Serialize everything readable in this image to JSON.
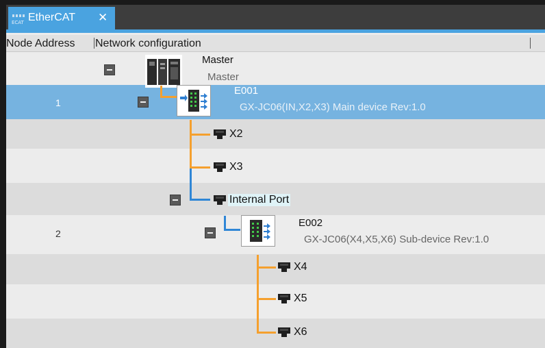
{
  "tab": {
    "label": "EtherCAT",
    "close_glyph": "✕",
    "icon": "ethercat-icon"
  },
  "header": {
    "node_address": "Node Address",
    "network_configuration": "Network configuration"
  },
  "master": {
    "name": "Master",
    "model": "Master"
  },
  "devices": [
    {
      "address": "1",
      "name": "E001",
      "model": "GX-JC06(IN,X2,X3) Main device Rev:1.0",
      "selected": true
    },
    {
      "address": "2",
      "name": "E002",
      "model": "GX-JC06(X4,X5,X6) Sub-device Rev:1.0",
      "selected": false
    }
  ],
  "ports": {
    "e001": [
      "X2",
      "X3",
      "Internal Port"
    ],
    "e002": [
      "X4",
      "X5",
      "X6"
    ]
  },
  "colors": {
    "accent": "#4aa3e0",
    "selection": "#76b3e0",
    "cable_orange": "#f5a02e",
    "cable_blue": "#2f86d6"
  }
}
